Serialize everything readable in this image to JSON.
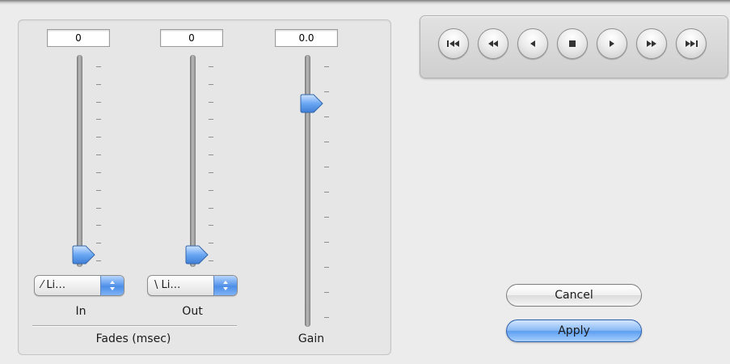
{
  "fades": {
    "in": {
      "value": "0",
      "type_label": "Li…",
      "label": "In"
    },
    "out": {
      "value": "0",
      "type_label": "Li…",
      "label": "Out"
    },
    "group_label": "Fades (msec)"
  },
  "gain": {
    "value": "0.0",
    "label": "Gain"
  },
  "transport": {
    "buttons": [
      "skip-to-start",
      "rewind",
      "step-back",
      "stop",
      "play",
      "fast-forward",
      "skip-to-end"
    ]
  },
  "actions": {
    "cancel_label": "Cancel",
    "apply_label": "Apply"
  },
  "colors": {
    "accent": "#5d9ef0",
    "thumb": "#6aa7f3"
  }
}
